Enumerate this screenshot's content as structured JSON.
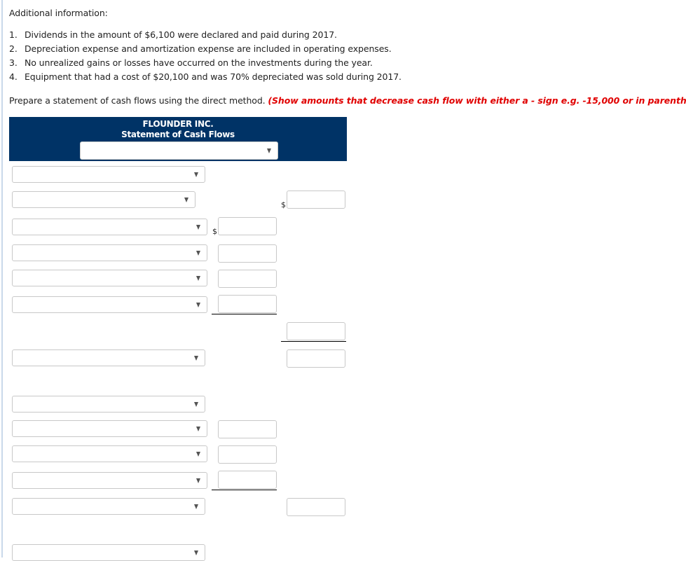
{
  "additional_info": {
    "heading": "Additional information:",
    "items": [
      {
        "number": "1.",
        "text": "Dividends in the amount of $6,100 were declared and paid during 2017."
      },
      {
        "number": "2.",
        "text": "Depreciation expense and amortization expense are included in operating expenses."
      },
      {
        "number": "3.",
        "text": "No unrealized gains or losses have occurred on the investments during the year."
      },
      {
        "number": "4.",
        "text": "Equipment that had a cost of $20,100 and was 70% depreciated was sold during 2017."
      }
    ]
  },
  "instruction": {
    "text": "Prepare a statement of cash flows using the direct method.",
    "hint": "(Show amounts that decrease cash flow with either a - sign e.g. -15,000 or in parenthesis"
  },
  "statement": {
    "company": "FLOUNDER INC.",
    "title": "Statement of Cash Flows",
    "period_select": {
      "selected": "",
      "icon": "chevron-down-icon"
    },
    "currency_symbol": "$",
    "rows": [
      {
        "select_value": "",
        "col2_value": null,
        "col3_value": null
      },
      {
        "select_value": "",
        "col2_value": null,
        "col3_value": ""
      },
      {
        "select_value": "",
        "col2_value": "",
        "col3_value": null
      },
      {
        "select_value": "",
        "col2_value": "",
        "col3_value": null
      },
      {
        "select_value": "",
        "col2_value": "",
        "col3_value": null
      },
      {
        "select_value": "",
        "col2_value": "",
        "col3_value": null
      },
      {
        "select_value": null,
        "col2_value": null,
        "col3_value": ""
      },
      {
        "select_value": "",
        "col2_value": null,
        "col3_value": ""
      },
      {
        "select_value": "",
        "col2_value": null,
        "col3_value": null
      },
      {
        "select_value": "",
        "col2_value": "",
        "col3_value": null
      },
      {
        "select_value": "",
        "col2_value": "",
        "col3_value": null
      },
      {
        "select_value": "",
        "col2_value": "",
        "col3_value": null
      },
      {
        "select_value": "",
        "col2_value": null,
        "col3_value": ""
      },
      {
        "select_value": "",
        "col2_value": null,
        "col3_value": null
      }
    ]
  }
}
